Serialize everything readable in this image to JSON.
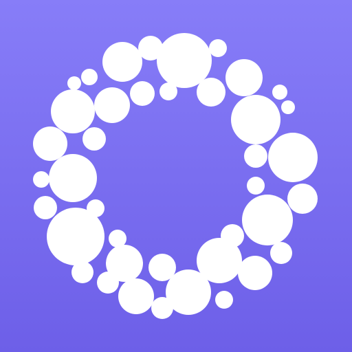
{
  "icon": {
    "name": "bubble-ring-app-icon",
    "shape": "ring of white circles",
    "colors": {
      "background_top": "#877df8",
      "background_bottom": "#6d5fe8",
      "circles": "#ffffff"
    }
  }
}
